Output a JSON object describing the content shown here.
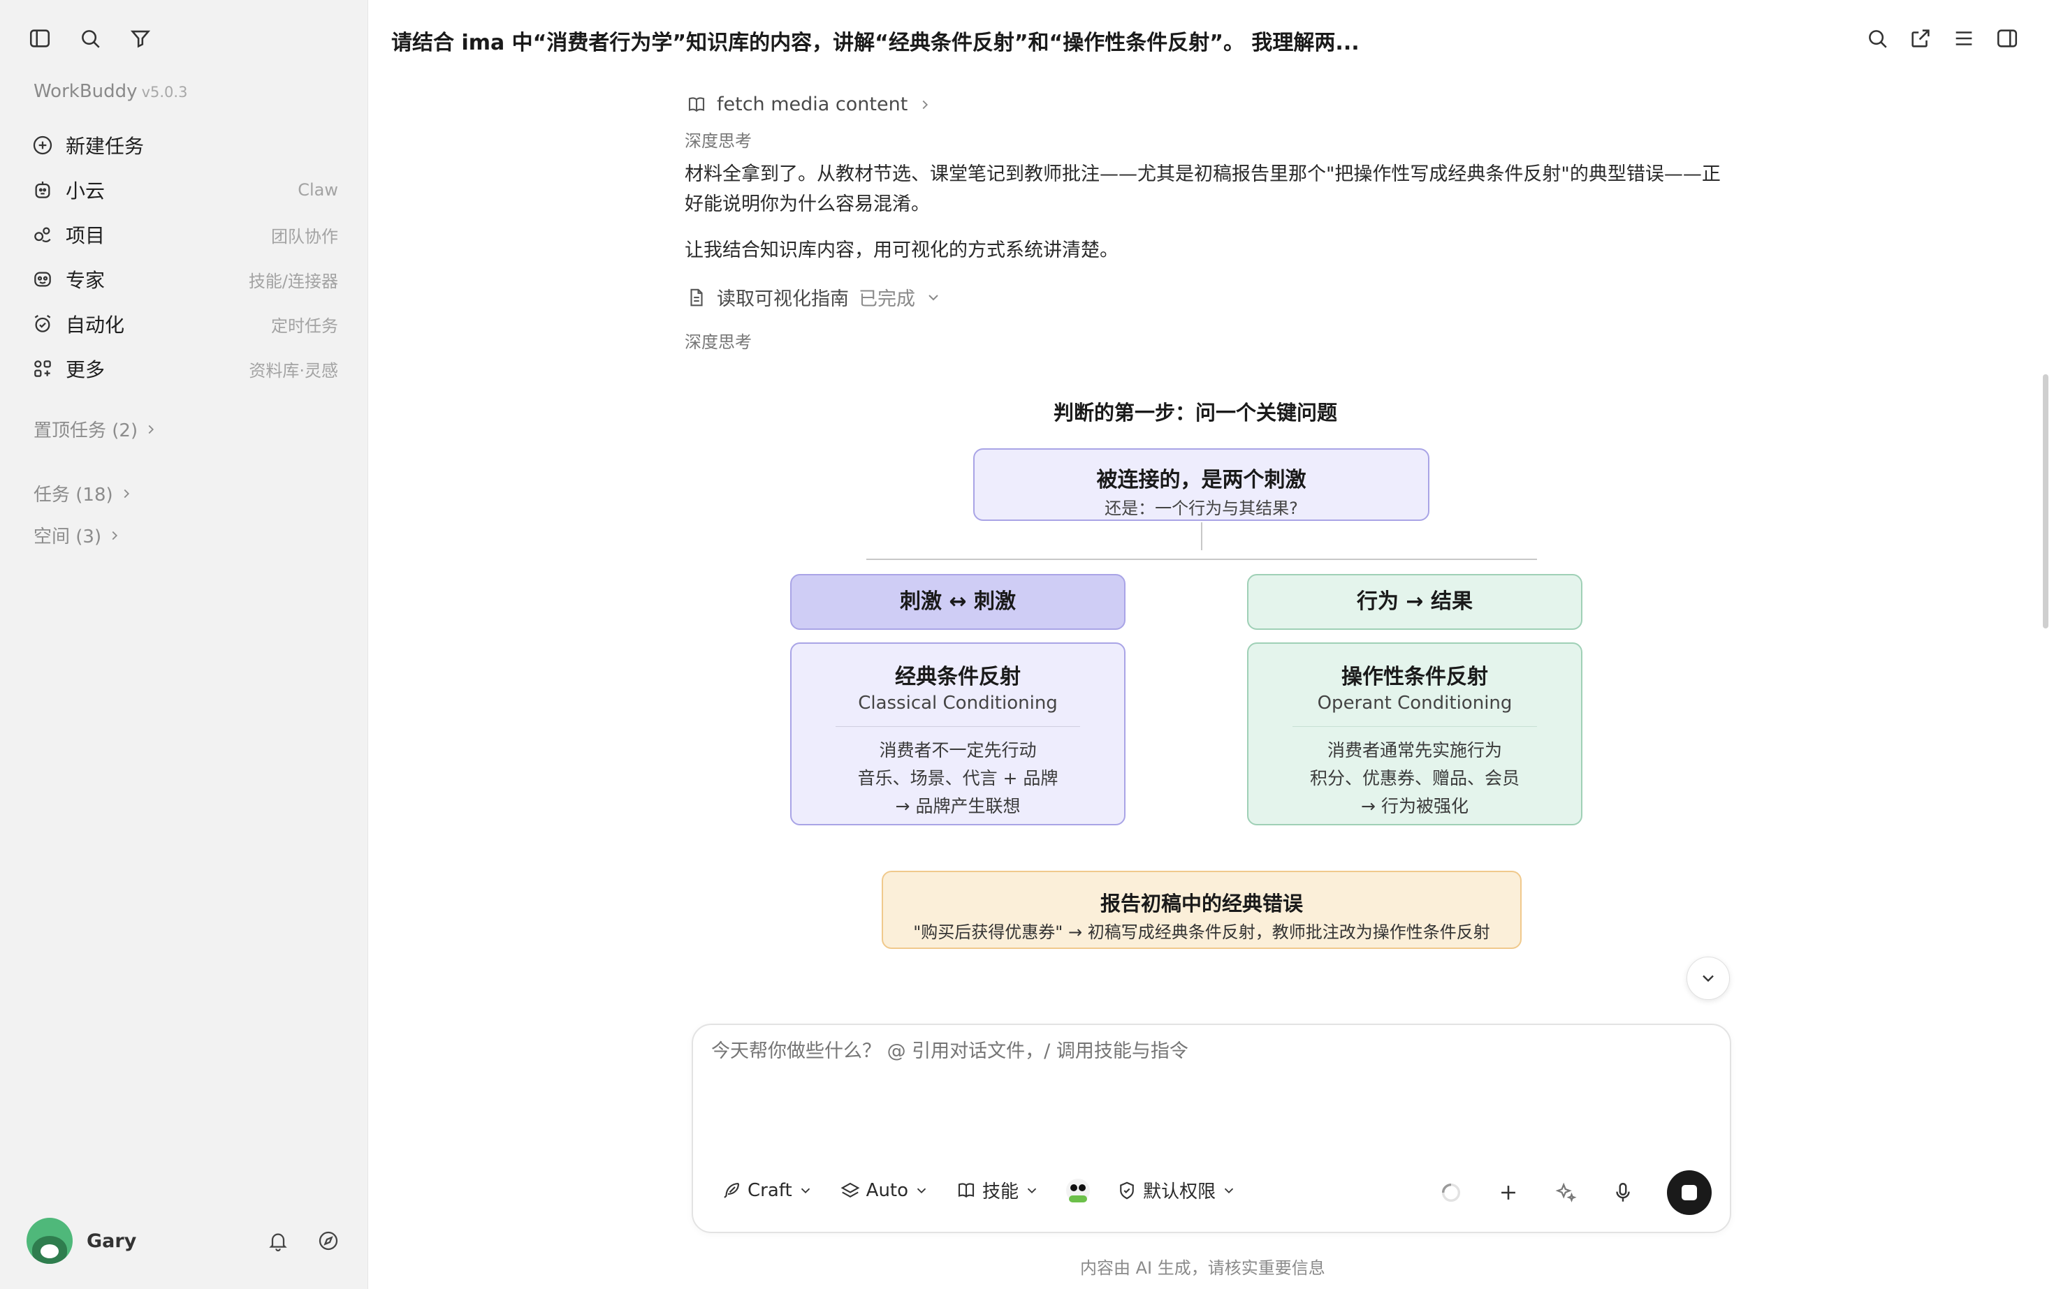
{
  "sidebar": {
    "brand": "WorkBuddy",
    "version": "v5.0.3",
    "nav": [
      {
        "label": "新建任务",
        "hint": "",
        "icon": "plus-circle-icon"
      },
      {
        "label": "小云",
        "hint": "Claw",
        "icon": "robot-icon"
      },
      {
        "label": "项目",
        "hint": "团队协作",
        "icon": "project-icon"
      },
      {
        "label": "专家",
        "hint": "技能/连接器",
        "icon": "expert-icon"
      },
      {
        "label": "自动化",
        "hint": "定时任务",
        "icon": "alarm-clock-icon"
      },
      {
        "label": "更多",
        "hint": "资料库·灵感",
        "icon": "grid-icon"
      }
    ],
    "pinned": "置顶任务 (2)",
    "tasks": "任务 (18)",
    "spaces": "空间 (3)",
    "user": "Gary"
  },
  "header": {
    "title": "请结合 ima 中“消费者行为学”知识库的内容，讲解“经典条件反射”和“操作性条件反射”。 我理解两..."
  },
  "chat": {
    "tool_fetch": "fetch media content",
    "thinking_1": "深度思考",
    "para_1": "材料全拿到了。从教材节选、课堂笔记到教师批注——尤其是初稿报告里那个\"把操作性写成经典条件反射\"的典型错误——正好能说明你为什么容易混淆。",
    "para_2": "让我结合知识库内容，用可视化的方式系统讲清楚。",
    "tool_read": "读取可视化指南",
    "tool_read_status": "已完成",
    "thinking_2": "深度思考"
  },
  "diagram": {
    "title": "判断的第一步：问一个关键问题",
    "question_main": "被连接的，是两个刺激",
    "question_sub": "还是：一个行为与其结果?",
    "left_head": "刺激 ↔ 刺激",
    "right_head": "行为 → 结果",
    "left_card": {
      "title": "经典条件反射",
      "subtitle": "Classical Conditioning",
      "lines": [
        "消费者不一定先行动",
        "音乐、场景、代言 + 品牌",
        "→ 品牌产生联想"
      ]
    },
    "right_card": {
      "title": "操作性条件反射",
      "subtitle": "Operant Conditioning",
      "lines": [
        "消费者通常先实施行为",
        "积分、优惠券、赠品、会员",
        "→ 行为被强化"
      ]
    },
    "error_title": "报告初稿中的经典错误",
    "error_text": "\"购买后获得优惠券\" → 初稿写成经典条件反射，教师批注改为操作性条件反射"
  },
  "composer": {
    "placeholder": "今天帮你做些什么？ @ 引用对话文件，/ 调用技能与指令",
    "mode": "Craft",
    "model": "Auto",
    "skills": "技能",
    "permission": "默认权限"
  },
  "footer": "内容由 AI 生成，请核实重要信息",
  "colors": {
    "purple_fill": "#eeedfd",
    "purple_head": "#cfcdf5",
    "green_fill": "#e4f4ec",
    "orange_fill": "#fbefd9"
  }
}
